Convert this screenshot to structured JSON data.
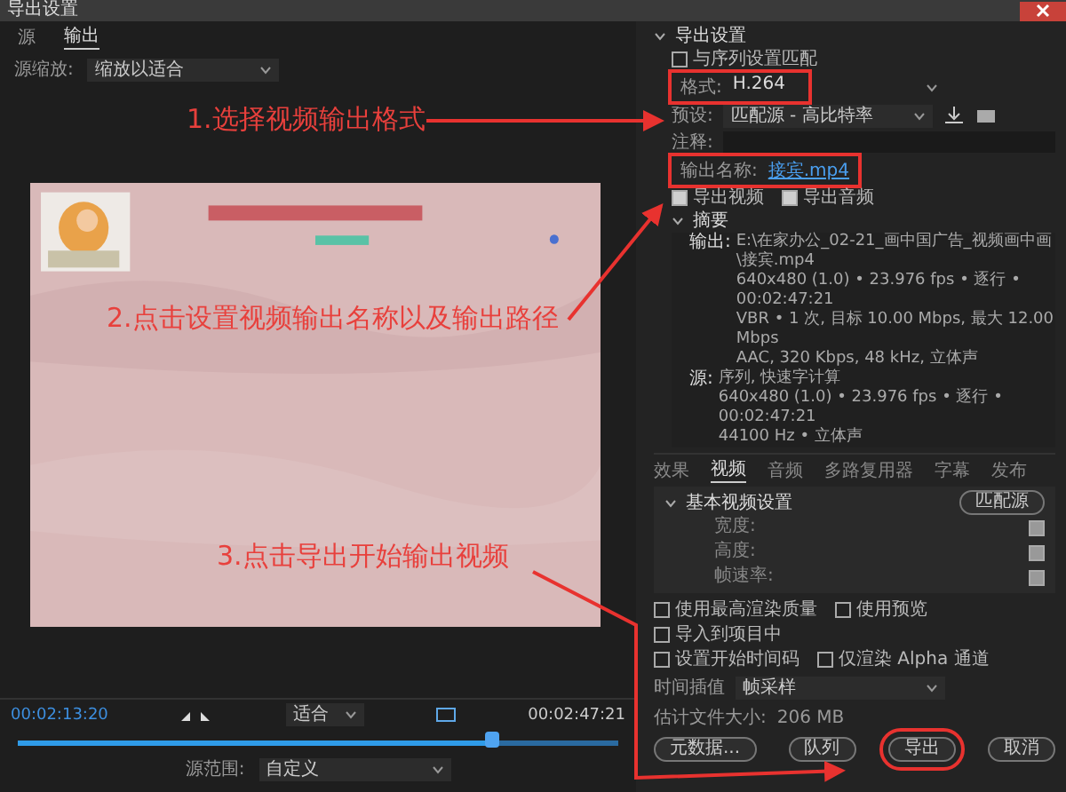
{
  "window": {
    "title": "导出设置"
  },
  "left_tabs": [
    {
      "label": "源",
      "selected": false
    },
    {
      "label": "输出",
      "selected": true
    }
  ],
  "source_scaling": {
    "label": "源缩放:",
    "value": "缩放以适合"
  },
  "preview": {
    "kind": "picture"
  },
  "timeline": {
    "current": "00:02:13:20",
    "fit": "适合",
    "end": "00:02:47:21",
    "level": 0.79,
    "range_label": "源范围:",
    "range_value": "自定义"
  },
  "export_settings": {
    "title": "导出设置",
    "expanded": true,
    "match_sequence": {
      "label": "与序列设置匹配",
      "checked": false
    },
    "format": {
      "label": "格式:",
      "value": "H.264"
    },
    "preset": {
      "label": "预设:",
      "value": "匹配源 - 高比特率"
    },
    "comment": {
      "label": "注释:"
    },
    "output_name": {
      "label": "输出名称:",
      "value": "接宾.mp4"
    },
    "export_checks": [
      {
        "label": "导出视频",
        "checked": true
      },
      {
        "label": "导出音频",
        "checked": true
      }
    ],
    "summary": {
      "title": "摘要",
      "expanded": true,
      "groups": [
        {
          "label": "输出:",
          "lines": [
            "E:\\在家办公_02-21_画中国广告_视频画中画\\接宾.mp4",
            "640x480 (1.0) • 23.976 fps • 逐行 • 00:02:47:21",
            "VBR • 1 次, 目标 10.00 Mbps, 最大 12.00 Mbps",
            "AAC, 320 Kbps, 48 kHz, 立体声"
          ]
        },
        {
          "label": "源:",
          "lines": [
            "序列, 快速字计算",
            "640x480 (1.0) • 23.976 fps • 逐行 • 00:02:47:21",
            "44100 Hz • 立体声"
          ]
        }
      ]
    }
  },
  "settings_tabs": [
    {
      "label": "效果",
      "selected": false
    },
    {
      "label": "视频",
      "selected": true
    },
    {
      "label": "音频",
      "selected": false
    },
    {
      "label": "多路复用器",
      "selected": false
    },
    {
      "label": "字幕",
      "selected": false
    },
    {
      "label": "发布",
      "selected": false
    }
  ],
  "video_settings": {
    "title": "基本视频设置",
    "expanded": true,
    "match_button": "匹配源",
    "fields": [
      {
        "label": "宽度:",
        "checked": true
      },
      {
        "label": "高度:",
        "checked": true
      },
      {
        "label": "帧速率:",
        "checked": true
      }
    ]
  },
  "options": [
    {
      "label": "使用最高渲染质量",
      "checked": false
    },
    {
      "label": "使用预览",
      "checked": false
    },
    {
      "label": "导入到项目中",
      "checked": false
    },
    {
      "label": "设置开始时间码",
      "checked": false
    },
    {
      "label": "仅渲染 Alpha 通道",
      "checked": false
    }
  ],
  "time_interpolation": {
    "label": "时间插值",
    "value": "帧采样"
  },
  "file_size": {
    "label": "估计文件大小:",
    "value": "206 MB"
  },
  "buttons": [
    "元数据...",
    "队列",
    "导出",
    "取消"
  ],
  "annotations": [
    "1.选择视频输出格式",
    "2.点击设置视频输出名称以及输出路径",
    "3.点击导出开始输出视频"
  ]
}
